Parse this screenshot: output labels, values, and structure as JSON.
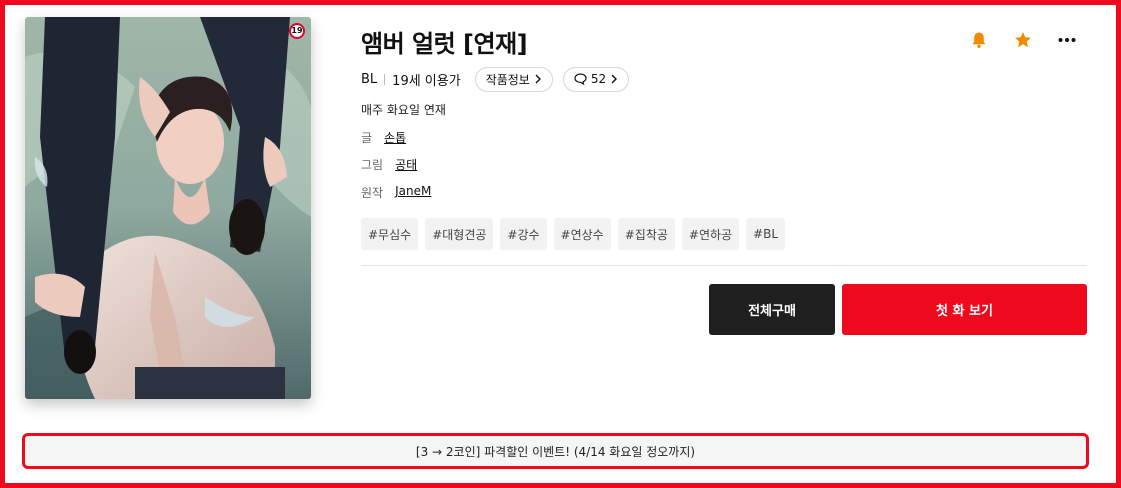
{
  "series": {
    "title": "앰버 얼럿 [연재]",
    "genre": "BL",
    "rating": "19세 이용가",
    "age_badge": "19",
    "info_pill": "작품정보",
    "comment_count": "52",
    "schedule": "매주 화요일 연재",
    "credits": [
      {
        "label": "글",
        "value": "손톱"
      },
      {
        "label": "그림",
        "value": "공태"
      },
      {
        "label": "원작",
        "value": "JaneM"
      }
    ],
    "tags": [
      "#무심수",
      "#대형견공",
      "#강수",
      "#연상수",
      "#집착공",
      "#연하공",
      "#BL"
    ]
  },
  "buttons": {
    "buy_all": "전체구매",
    "first_episode": "첫 화 보기"
  },
  "event_banner": "[3 → 2코인] 파격할인 이벤트! (4/14 화요일 정오까지)",
  "icons": {
    "alert": "bell-icon",
    "favorite": "star-icon",
    "more": "more-icon",
    "comment": "speech-bubble-icon",
    "chevron": "chevron-right-icon"
  },
  "colors": {
    "accent_red": "#ee0a1c",
    "icon_orange": "#f08a00",
    "dark_button": "#1f1f1f"
  }
}
